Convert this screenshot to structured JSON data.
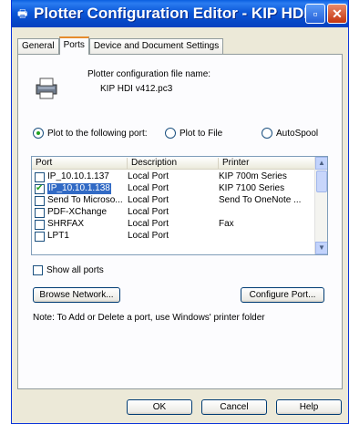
{
  "window": {
    "title": "Plotter Configuration Editor - KIP HDI"
  },
  "tabs": [
    "General",
    "Ports",
    "Device and Document Settings"
  ],
  "config": {
    "file_label": "Plotter configuration file name:",
    "file_name": "KIP HDI v412.pc3"
  },
  "radios": [
    {
      "label": "Plot to the following port:",
      "selected": true
    },
    {
      "label": "Plot to File",
      "selected": false
    },
    {
      "label": "AutoSpool",
      "selected": false
    }
  ],
  "ports_table": {
    "columns": [
      "Port",
      "Description",
      "Printer"
    ],
    "rows": [
      {
        "port": "IP_10.10.1.137",
        "description": "Local Port",
        "printer": "KIP 700m Series",
        "checked": false
      },
      {
        "port": "IP_10.10.1.138",
        "description": "Local Port",
        "printer": "KIP 7100 Series",
        "checked": true
      },
      {
        "port": "Send To Microso...",
        "description": "Local Port",
        "printer": "Send To OneNote ...",
        "checked": false
      },
      {
        "port": "PDF-XChange",
        "description": "Local Port",
        "printer": "",
        "checked": false
      },
      {
        "port": "SHRFAX",
        "description": "Local Port",
        "printer": "Fax",
        "checked": false
      },
      {
        "port": "LPT1",
        "description": "Local Port",
        "printer": "",
        "checked": false
      }
    ]
  },
  "show_all_label": "Show all ports",
  "buttons": {
    "browse": "Browse Network...",
    "configure": "Configure Port...",
    "ok": "OK",
    "cancel": "Cancel",
    "help": "Help"
  },
  "note": "Note: To Add or Delete a port, use Windows' printer folder"
}
